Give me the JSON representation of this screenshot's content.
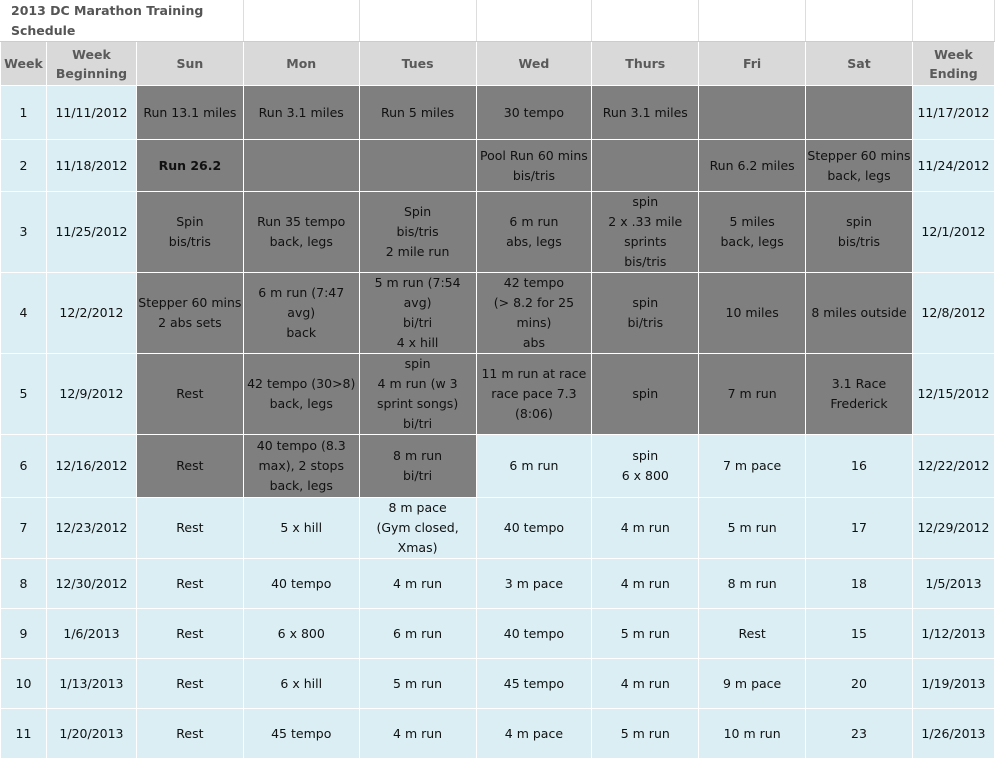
{
  "title": "2013 DC Marathon Training Schedule",
  "colors": {
    "header_bg": "#d9d9d9",
    "completed_bg": "#7f7f7f",
    "planned_bg": "#daeef3",
    "title_text": "#555555"
  },
  "headers": [
    "Week",
    "Week\nBeginning",
    "Sun",
    "Mon",
    "Tues",
    "Wed",
    "Thurs",
    "Fri",
    "Sat",
    "Week\nEnding"
  ],
  "rows": [
    {
      "cells": [
        "1",
        "11/11/2012",
        "Run 13.1 miles",
        "Run 3.1 miles",
        "Run 5 miles",
        "30 tempo",
        "Run 3.1 miles",
        "",
        "",
        "11/17/2012"
      ],
      "dark": [
        2,
        3,
        4,
        5,
        6,
        7,
        8
      ]
    },
    {
      "cells": [
        "2",
        "11/18/2012",
        "Run 26.2",
        "",
        "",
        "Pool Run 60 mins\nbis/tris",
        "",
        "Run 6.2 miles",
        "Stepper 60 mins\nback, legs",
        "11/24/2012"
      ],
      "dark": [
        2,
        3,
        4,
        5,
        6,
        7,
        8
      ],
      "bold": [
        2
      ]
    },
    {
      "cells": [
        "3",
        "11/25/2012",
        "Spin\nbis/tris",
        "Run 35 tempo\nback, legs",
        "Spin\nbis/tris\n2 mile run",
        "6 m run\nabs, legs",
        "spin\n2 x .33 mile\nsprints\nbis/tris",
        "5 miles\nback, legs",
        "spin\nbis/tris",
        "12/1/2012"
      ],
      "dark": [
        2,
        3,
        4,
        5,
        6,
        7,
        8
      ]
    },
    {
      "cells": [
        "4",
        "12/2/2012",
        "Stepper 60 mins\n2 abs sets",
        "6 m run (7:47 avg)\nback",
        "5 m run (7:54 avg)\nbi/tri\n4 x hill",
        "42 tempo\n(> 8.2 for 25 mins)\nabs",
        "spin\nbi/tris",
        "10 miles",
        "8 miles outside",
        "12/8/2012"
      ],
      "dark": [
        2,
        3,
        4,
        5,
        6,
        7,
        8
      ]
    },
    {
      "cells": [
        "5",
        "12/9/2012",
        "Rest",
        "42 tempo (30>8)\nback, legs",
        "spin\n4 m run (w 3\nsprint songs)\nbi/tri",
        "11 m run at race\nrace pace 7.3\n(8:06)",
        "spin",
        "7 m run",
        "3.1 Race\nFrederick",
        "12/15/2012"
      ],
      "dark": [
        2,
        3,
        4,
        5,
        6,
        7,
        8
      ]
    },
    {
      "cells": [
        "6",
        "12/16/2012",
        "Rest",
        "40 tempo (8.3\nmax), 2 stops\nback, legs",
        "8 m run\nbi/tri",
        "6 m run",
        "spin\n6 x 800",
        "7 m pace",
        "16",
        "12/22/2012"
      ],
      "dark": [
        2,
        3,
        4
      ]
    },
    {
      "cells": [
        "7",
        "12/23/2012",
        "Rest",
        "5 x hill",
        "8 m pace\n(Gym closed,\nXmas)",
        "40 tempo",
        "4 m run",
        "5 m run",
        "17",
        "12/29/2012"
      ],
      "dark": []
    },
    {
      "cells": [
        "8",
        "12/30/2012",
        "Rest",
        "40 tempo",
        "4 m run",
        "3 m pace",
        "4 m run",
        "8 m run",
        "18",
        "1/5/2013"
      ],
      "dark": []
    },
    {
      "cells": [
        "9",
        "1/6/2013",
        "Rest",
        "6 x 800",
        "6 m run",
        "40 tempo",
        "5 m run",
        "Rest",
        "15",
        "1/12/2013"
      ],
      "dark": []
    },
    {
      "cells": [
        "10",
        "1/13/2013",
        "Rest",
        "6 x hill",
        "5 m run",
        "45 tempo",
        "4 m run",
        "9 m pace",
        "20",
        "1/19/2013"
      ],
      "dark": []
    },
    {
      "cells": [
        "11",
        "1/20/2013",
        "Rest",
        "45 tempo",
        "4 m run",
        "4 m pace",
        "5 m run",
        "10 m run",
        "23",
        "1/26/2013"
      ],
      "dark": []
    }
  ]
}
